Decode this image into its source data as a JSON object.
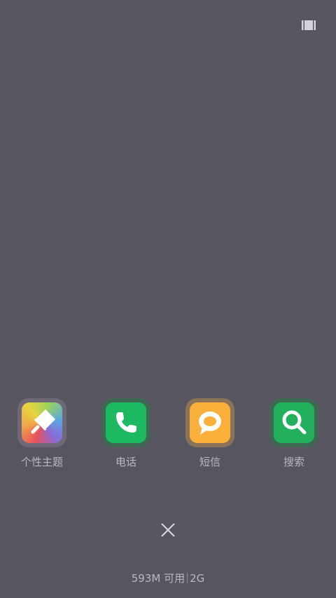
{
  "header": {
    "recents_icon": "view-toggle-icon"
  },
  "apps": [
    {
      "label": "个性主题",
      "icon": "brush-icon",
      "frame_color": "#7b6f88",
      "icon_color": "#e8a23c"
    },
    {
      "label": "电话",
      "icon": "phone-icon",
      "frame_color": "#3f6a52",
      "icon_color": "#1fb762"
    },
    {
      "label": "短信",
      "icon": "chat-bubble-icon",
      "frame_color": "#8a7358",
      "icon_color": "#fbb03b"
    },
    {
      "label": "搜索",
      "icon": "search-icon",
      "frame_color": "#3f6a52",
      "icon_color": "#23b05c"
    }
  ],
  "footer": {
    "close_icon": "close-icon",
    "memory_text": "593M 可用",
    "total_text": "2G"
  }
}
